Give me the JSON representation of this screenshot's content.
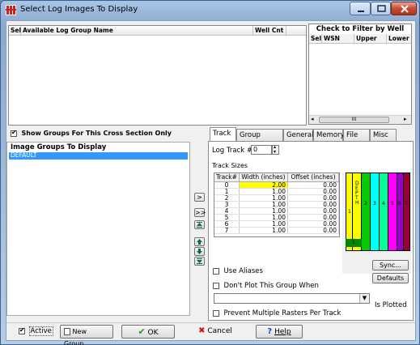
{
  "window": {
    "title": "Select Log Images To Display"
  },
  "log_groups_table": {
    "columns": [
      "Sel",
      "Available Log Group Name",
      "Well Cnt"
    ]
  },
  "filter_panel": {
    "title": "Check to Filter by Well",
    "columns": [
      "Sel",
      "WSN",
      "Upper",
      "Lower"
    ],
    "scroll_thumb": "III"
  },
  "show_groups_checkbox": {
    "label": "Show Groups For This Cross Section Only",
    "checked": true
  },
  "image_groups": {
    "title": "Image Groups To Display",
    "items": [
      "DEFAULT"
    ]
  },
  "tabs": [
    "Track",
    "Group Options",
    "General",
    "Memory",
    "File",
    "Misc"
  ],
  "track": {
    "log_track_label": "Log Track #",
    "log_track_value": "0",
    "sizes_label": "Track Sizes",
    "columns": [
      "Track#",
      "Width (inches)",
      "Offset (inches)"
    ],
    "rows": [
      [
        "0",
        "2.00",
        "0.00"
      ],
      [
        "1",
        "1.00",
        "0.00"
      ],
      [
        "2",
        "1.00",
        "0.00"
      ],
      [
        "3",
        "1.00",
        "0.00"
      ],
      [
        "4",
        "1.00",
        "0.00"
      ],
      [
        "5",
        "1.00",
        "0.00"
      ],
      [
        "6",
        "1.00",
        "0.00"
      ],
      [
        "7",
        "1.00",
        "0.00"
      ]
    ]
  },
  "move_buttons": [
    ">",
    ">>"
  ],
  "preview": {
    "labels": [
      "1",
      "D\nE\nP\nT\nH",
      "2",
      "3",
      "4",
      "5",
      "6",
      "7"
    ],
    "bottom_label": "1",
    "colors": [
      "#ffff00",
      "#00cc00",
      "#00ffff",
      "#00ff99",
      "#ff00ff",
      "#9900cc",
      "#cc0066",
      "#990033"
    ]
  },
  "options": {
    "use_aliases": "Use Aliases",
    "dont_plot": "Don't Plot This Group When",
    "is_plotted": "Is Plotted",
    "prevent_multiple": "Prevent Multiple Rasters Per Track",
    "sync": "Sync...",
    "defaults": "Defaults"
  },
  "footer": {
    "active_label": "Active",
    "new_group": "New Group...",
    "ok": "OK",
    "cancel": "Cancel",
    "help": "Help"
  }
}
